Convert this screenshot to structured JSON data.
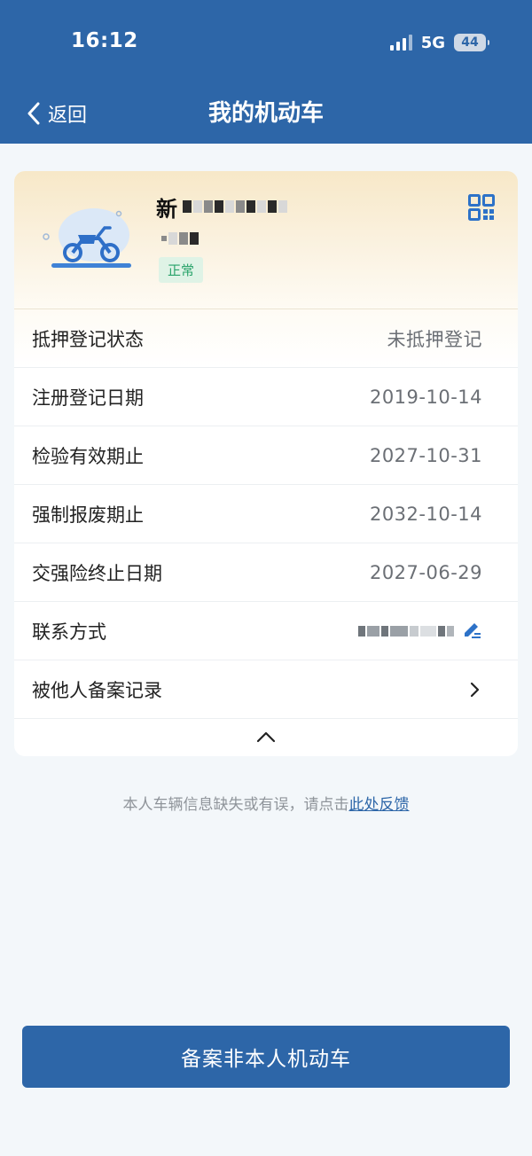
{
  "status_bar": {
    "time": "16:12",
    "network": "5G",
    "battery": "44"
  },
  "nav": {
    "back_label": "返回",
    "title": "我的机动车"
  },
  "vehicle": {
    "plate_prefix": "新",
    "status": "正常"
  },
  "rows": [
    {
      "label": "抵押登记状态",
      "value": "未抵押登记"
    },
    {
      "label": "注册登记日期",
      "value": "2019-10-14"
    },
    {
      "label": "检验有效期止",
      "value": "2027-10-31"
    },
    {
      "label": "强制报废期止",
      "value": "2032-10-14"
    },
    {
      "label": "交强险终止日期",
      "value": "2027-06-29"
    },
    {
      "label": "联系方式",
      "value": ""
    },
    {
      "label": "被他人备案记录",
      "value": ""
    }
  ],
  "feedback": {
    "text": "本人车辆信息缺失或有误，请点击",
    "link": "此处反馈"
  },
  "bottom_button": {
    "label": "备案非本人机动车"
  },
  "colors": {
    "brand": "#2d66a8",
    "status_green": "#29a36a"
  },
  "icons": {
    "back": "chevron-left-icon",
    "qr": "qr-code-icon",
    "edit": "edit-pen-icon",
    "more": "chevron-right-icon",
    "collapse": "chevron-up-icon",
    "vehicle": "motorcycle-icon"
  }
}
